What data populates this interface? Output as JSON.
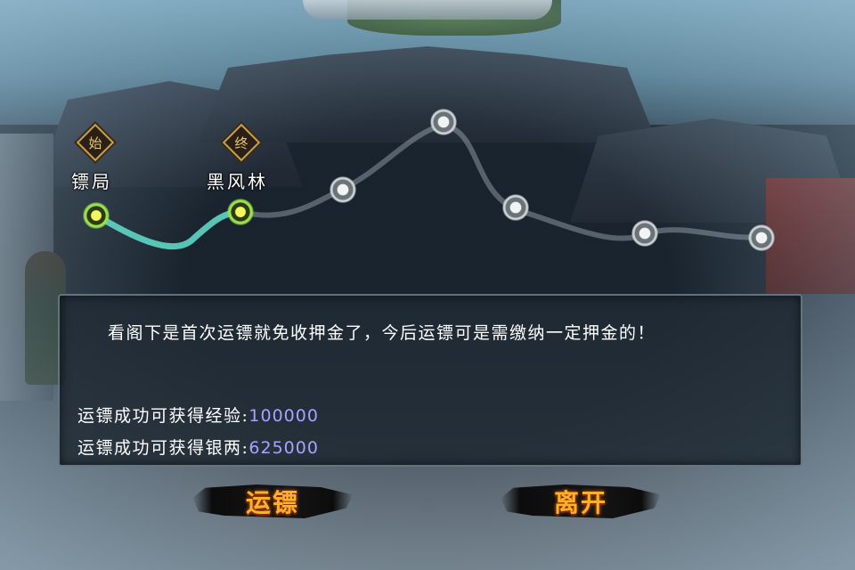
{
  "route": {
    "start_badge": "始",
    "end_badge": "终",
    "start_location": "镖局",
    "end_location": "黑风林"
  },
  "dialog": {
    "message": "看阁下是首次运镖就免收押金了，今后运镖可是需缴纳一定押金的！",
    "exp_label": "运镖成功可获得经验:",
    "exp_value": "100000",
    "silver_label": "运镖成功可获得银两:",
    "silver_value": "625000"
  },
  "buttons": {
    "escort": "运镖",
    "leave": "离开"
  },
  "colors": {
    "reward_value": "#a7a2ff",
    "button_text": "#ffb02a",
    "route_active": "#5fd6c8",
    "badge_border": "#c9a04a"
  }
}
